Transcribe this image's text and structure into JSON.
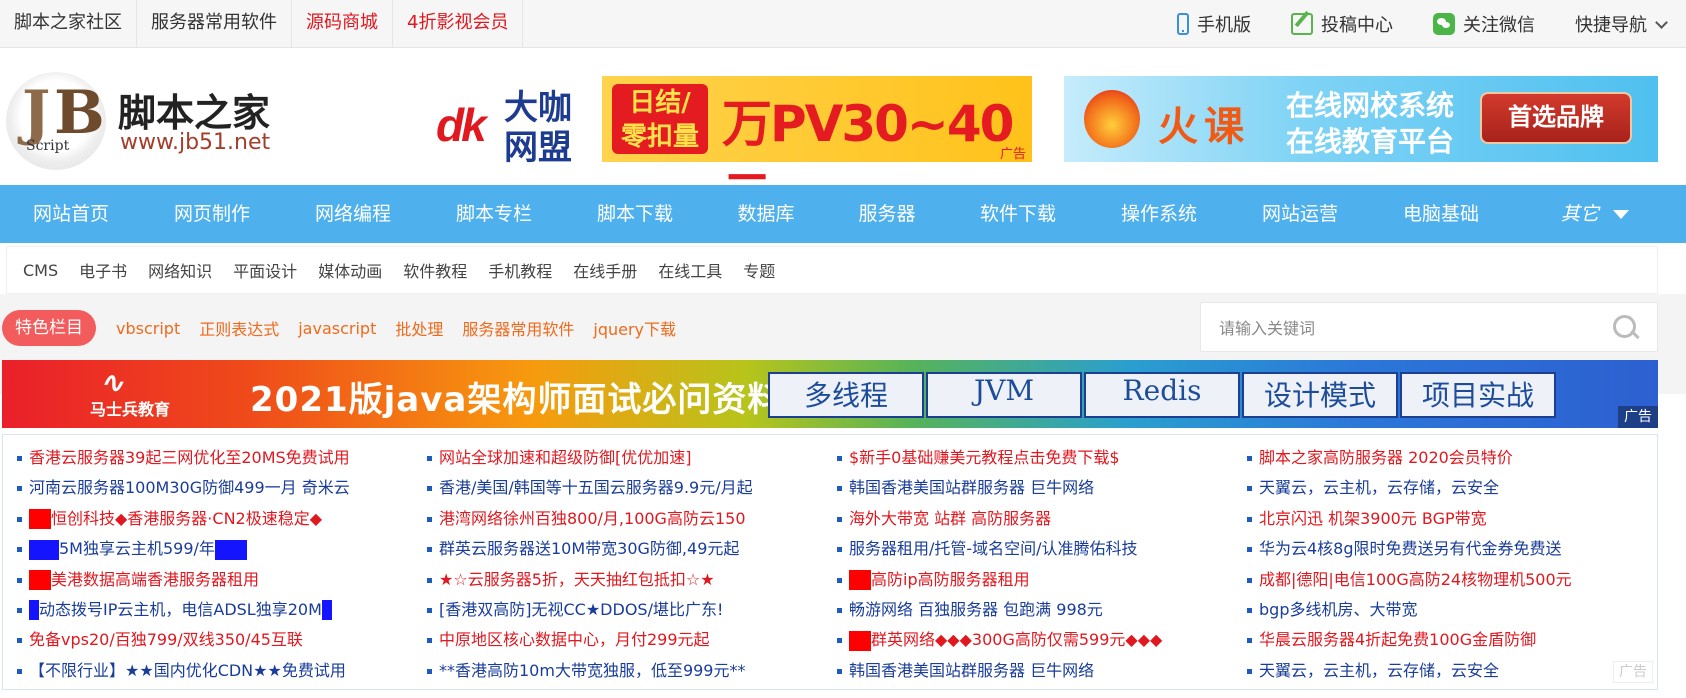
{
  "topbar": {
    "links": [
      {
        "label": "脚本之家社区",
        "color": "normal"
      },
      {
        "label": "服务器常用软件",
        "color": "normal"
      },
      {
        "label": "源码商城",
        "color": "red"
      },
      {
        "label": "4折影视会员",
        "color": "red"
      }
    ],
    "mobile_label": "手机版",
    "submit_label": "投稿中心",
    "wechat_label": "关注微信",
    "quicknav_label": "快捷导航"
  },
  "header": {
    "logo_name": "脚本之家",
    "logo_url": "www.jb51.net",
    "logo_script": "Script"
  },
  "ad1": {
    "brand_logo": "dk",
    "brand_line1": "大咖",
    "brand_line2": "网盟",
    "box_line1": "日结/",
    "box_line2": "零扣量",
    "headline": "万PV30~40元",
    "tag": "广告"
  },
  "ad2": {
    "name": "火课",
    "line1": "在线网校系统",
    "line2": "在线教育平台",
    "button": "首选品牌"
  },
  "mainnav": {
    "items": [
      "网站首页",
      "网页制作",
      "网络编程",
      "脚本专栏",
      "脚本下载",
      "数据库",
      "服务器",
      "软件下载",
      "操作系统",
      "网站运营",
      "电脑基础"
    ],
    "more": "其它"
  },
  "subnav": {
    "items": [
      "CMS",
      "电子书",
      "网络知识",
      "平面设计",
      "媒体动画",
      "软件教程",
      "手机教程",
      "在线手册",
      "在线工具",
      "专题"
    ]
  },
  "special": {
    "label": "特色栏目",
    "tags": [
      "vbscript",
      "正则表达式",
      "javascript",
      "批处理",
      "服务器常用软件",
      "jquery下载"
    ]
  },
  "search": {
    "placeholder": "请输入关键词",
    "value": ""
  },
  "banner": {
    "brand": "马士兵教育",
    "title": "2021版java架构师面试必问资料",
    "tabs": [
      "多线程",
      "JVM",
      "Redis",
      "设计模式",
      "项目实战"
    ],
    "ad_label": "广告"
  },
  "links": {
    "col1": [
      {
        "text": "香港云服务器39起三网优化至20MS免费试用",
        "color": "red"
      },
      {
        "text": "河南云服务器100M30G防御499一月 奇米云",
        "color": "blue"
      },
      {
        "text": "恒创科技◆香港服务器·CN2极速稳定◆",
        "color": "red"
      },
      {
        "text": "5M独享云主机599/年",
        "color": "blue"
      },
      {
        "text": "美港数据高端香港服务器租用",
        "color": "red"
      },
      {
        "text": "动态拨号IP云主机，电信ADSL独享20M",
        "color": "blue"
      },
      {
        "text": "免备vps20/百独799/双线350/45互联",
        "color": "red"
      },
      {
        "text": "【不限行业】★★国内优化CDN★★免费试用",
        "color": "blue"
      }
    ],
    "col2": [
      {
        "text": "网站全球加速和超级防御[优优加速]",
        "color": "red"
      },
      {
        "text": "香港/美国/韩国等十五国云服务器9.9元/月起",
        "color": "blue"
      },
      {
        "text": "港湾网络徐州百独800/月,100G高防云150",
        "color": "red"
      },
      {
        "text": "群英云服务器送10M带宽30G防御,49元起",
        "color": "blue"
      },
      {
        "text": "★☆云服务器5折，天天抽红包抵扣☆★",
        "color": "red"
      },
      {
        "text": "[香港双高防]无视CC★DDOS/堪比广东!",
        "color": "blue"
      },
      {
        "text": "中原地区核心数据中心，月付299元起",
        "color": "red"
      },
      {
        "text": "**香港高防10m大带宽独服，低至999元**",
        "color": "blue"
      }
    ],
    "col3": [
      {
        "text": "$新手0基础赚美元教程点击免费下载$",
        "color": "red"
      },
      {
        "text": "韩国香港美国站群服务器 巨牛网络",
        "color": "blue"
      },
      {
        "text": "海外大带宽 站群 高防服务器",
        "color": "red"
      },
      {
        "text": "服务器租用/托管-域名空间/认准腾佑科技",
        "color": "blue"
      },
      {
        "text": "高防ip高防服务器租用",
        "color": "red"
      },
      {
        "text": "畅游网络 百独服务器 包跑满 998元",
        "color": "blue"
      },
      {
        "text": "群英网络◆◆◆300G高防仅需599元◆◆◆",
        "color": "red"
      },
      {
        "text": "韩国香港美国站群服务器 巨牛网络",
        "color": "blue"
      }
    ],
    "col4": [
      {
        "text": "脚本之家高防服务器 2020会员特价",
        "color": "red"
      },
      {
        "text": "天翼云，云主机，云存储，云安全",
        "color": "blue"
      },
      {
        "text": "北京闪迅 机架3900元 BGP带宽",
        "color": "red"
      },
      {
        "text": "华为云4核8g限时免费送另有代金券免费送",
        "color": "blue"
      },
      {
        "text": "成都|德阳|电信100G高防24核物理机500元",
        "color": "red"
      },
      {
        "text": "bgp多线机房、大带宽",
        "color": "blue"
      },
      {
        "text": "华晨云服务器4折起免费100G金盾防御",
        "color": "red"
      },
      {
        "text": "天翼云，云主机，云存储，云安全",
        "color": "blue"
      }
    ],
    "ad_label": "广告"
  }
}
